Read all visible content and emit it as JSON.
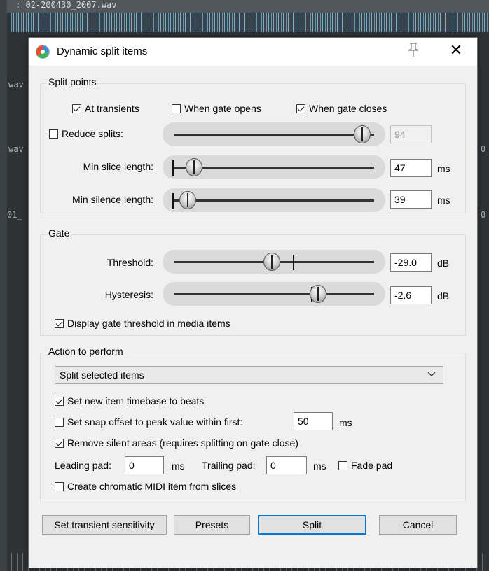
{
  "background": {
    "track_title": ": 02-200430_2007.wav",
    "side_labels": [
      "wav",
      "wav",
      "01_",
      "0",
      "0"
    ]
  },
  "dialog": {
    "title": "Dynamic split items",
    "icons": {
      "app": "reaper-icon",
      "pin": "pin-icon",
      "close": "close-icon"
    },
    "close_glyph": "✕"
  },
  "split_points": {
    "legend": "Split points",
    "at_transients": {
      "label": "At transients",
      "checked": true
    },
    "when_gate_opens": {
      "label": "When gate opens",
      "checked": false
    },
    "when_gate_closes": {
      "label": "When gate closes",
      "checked": true
    },
    "reduce_splits": {
      "label": "Reduce splits:",
      "checked": false,
      "value": "94",
      "level": 0.94
    },
    "min_slice_length": {
      "label": "Min slice length:",
      "value": "47",
      "unit": "ms",
      "level": 0.1
    },
    "min_silence_length": {
      "label": "Min silence length:",
      "value": "39",
      "unit": "ms",
      "level": 0.07
    }
  },
  "gate": {
    "legend": "Gate",
    "threshold": {
      "label": "Threshold:",
      "value": "-29.0",
      "unit": "dB",
      "level": 0.49
    },
    "hysteresis": {
      "label": "Hysteresis:",
      "value": "-2.6",
      "unit": "dB",
      "level": 0.72
    },
    "display_threshold": {
      "label": "Display gate threshold in media items",
      "checked": true
    }
  },
  "action": {
    "legend": "Action to perform",
    "selected": "Split selected items",
    "set_timebase": {
      "label": "Set new item timebase to beats",
      "checked": true
    },
    "snap_offset": {
      "label": "Set snap offset to peak value within first:",
      "checked": false,
      "value": "50",
      "unit": "ms"
    },
    "remove_silent": {
      "label": "Remove silent areas (requires splitting on gate close)",
      "checked": true
    },
    "leading_pad": {
      "label": "Leading pad:",
      "value": "0",
      "unit": "ms"
    },
    "trailing_pad": {
      "label": "Trailing pad:",
      "value": "0",
      "unit": "ms"
    },
    "fade_pad": {
      "label": "Fade pad",
      "checked": false
    },
    "chromatic_midi": {
      "label": "Create chromatic MIDI item from slices",
      "checked": false
    }
  },
  "buttons": {
    "set_transient": "Set transient sensitivity",
    "presets": "Presets",
    "split": "Split",
    "cancel": "Cancel"
  }
}
